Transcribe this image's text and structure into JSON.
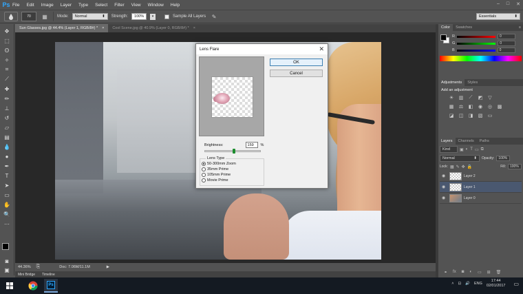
{
  "app": {
    "logo": "Ps",
    "menu": [
      "File",
      "Edit",
      "Image",
      "Layer",
      "Type",
      "Select",
      "Filter",
      "View",
      "Window",
      "Help"
    ],
    "window_controls": [
      "–",
      "□",
      "✕"
    ]
  },
  "options_bar": {
    "brush_size": "70",
    "mode_label": "Mode:",
    "mode_value": "Normal",
    "strength_label": "Strength:",
    "strength_value": "100%",
    "sample_all_layers_label": "Sample All Layers",
    "workspace": "Essentials"
  },
  "doc_tabs": [
    {
      "title": "Sun Glasses.jpg @ 44.4% (Layer 1, RGB/8#) *",
      "close": "×"
    },
    {
      "title": "Cool Scene.jpg @ 40.9% (Layer 0, RGB/8#) *",
      "close": "×"
    }
  ],
  "status_bar": {
    "zoom": "44.36%",
    "doc_info": "Doc: 7.06M/11.1M",
    "arrow": "▶"
  },
  "bottom_tabs": [
    "Mini Bridge",
    "Timeline"
  ],
  "color_panel": {
    "tabs": [
      "Color",
      "Swatches"
    ],
    "channels": [
      {
        "label": "R",
        "value": "0",
        "color": "#ff3030"
      },
      {
        "label": "G",
        "value": "0",
        "color": "#30c030"
      },
      {
        "label": "B",
        "value": "0",
        "color": "#3050ff"
      }
    ]
  },
  "adjustments_panel": {
    "tabs": [
      "Adjustments",
      "Styles"
    ],
    "title": "Add an adjustment"
  },
  "layers_panel": {
    "tabs": [
      "Layers",
      "Channels",
      "Paths"
    ],
    "kind_label": "Kind",
    "blend_mode": "Normal",
    "opacity_label": "Opacity:",
    "opacity_value": "100%",
    "lock_label": "Lock:",
    "fill_label": "Fill:",
    "fill_value": "100%",
    "layers": [
      {
        "name": "Layer 2",
        "selected": false
      },
      {
        "name": "Layer 1",
        "selected": true
      },
      {
        "name": "Layer 0",
        "selected": false
      }
    ]
  },
  "dialog": {
    "title": "Lens Flare",
    "ok_label": "OK",
    "cancel_label": "Cancel",
    "brightness_label": "Brightness:",
    "brightness_value": "159",
    "brightness_unit": "%",
    "brightness_fraction": 0.53,
    "lens_type_label": "Lens Type",
    "lens_options": [
      {
        "label": "50-300mm Zoom",
        "selected": true
      },
      {
        "label": "35mm Prime",
        "selected": false
      },
      {
        "label": "105mm Prime",
        "selected": false
      },
      {
        "label": "Movie Prime",
        "selected": false
      }
    ]
  },
  "taskbar": {
    "language": "ENG",
    "time": "17:44",
    "date": "02/01/2017"
  },
  "colors": {
    "accent": "#31a8ff",
    "selected_layer": "#4a5870",
    "ok_border": "#3c7fb1"
  }
}
